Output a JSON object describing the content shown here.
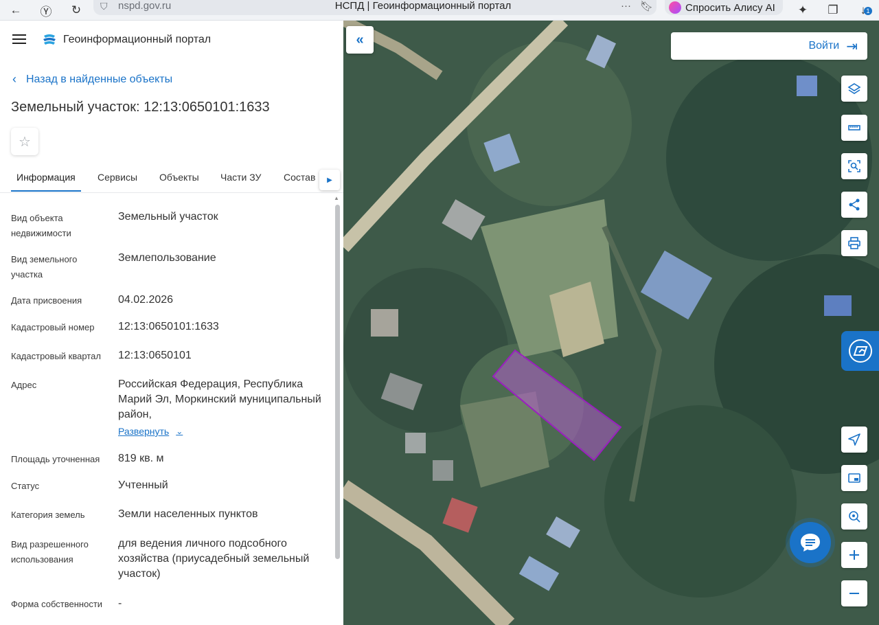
{
  "browser": {
    "url": "nspd.gov.ru",
    "tab_title": "НСПД | Геоинформационный портал",
    "alice_label": "Спросить Алису AI",
    "download_badge": "1"
  },
  "header": {
    "portal_title": "Геоинформационный портал"
  },
  "nav": {
    "back_label": "Назад в найденные объекты"
  },
  "object": {
    "title": "Земельный участок: 12:13:0650101:1633"
  },
  "tabs": [
    {
      "label": "Информация",
      "active": true
    },
    {
      "label": "Сервисы",
      "active": false
    },
    {
      "label": "Объекты",
      "active": false
    },
    {
      "label": "Части ЗУ",
      "active": false
    },
    {
      "label": "Состав",
      "active": false
    }
  ],
  "attributes": [
    {
      "label": "Вид объекта недвижимости",
      "value": "Земельный участок"
    },
    {
      "label": "Вид земельного участка",
      "value": "Землепользование"
    },
    {
      "label": "Дата присвоения",
      "value": "04.02.2026"
    },
    {
      "label": "Кадастровый номер",
      "value": "12:13:0650101:1633"
    },
    {
      "label": "Кадастровый квартал",
      "value": "12:13:0650101"
    },
    {
      "label": "Адрес",
      "value": "Российская Федерация, Республика Марий Эл, Моркинский муниципальный район,"
    },
    {
      "label": "Площадь уточненная",
      "value": "819 кв. м"
    },
    {
      "label": "Статус",
      "value": "Учтенный"
    },
    {
      "label": "Категория земель",
      "value": "Земли населенных пунктов"
    },
    {
      "label": "Вид разрешенного использования",
      "value": "для ведения личного подсобного хозяйства (приусадебный земельный участок)"
    },
    {
      "label": "Форма собственности",
      "value": "-"
    }
  ],
  "expand_label": "Развернуть",
  "map": {
    "login_label": "Войти",
    "parcel_color": "#a020c0",
    "accent": "#1a73c8"
  }
}
